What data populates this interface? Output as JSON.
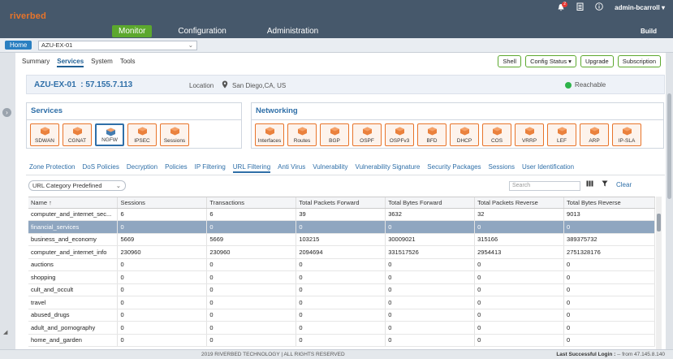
{
  "brand": {
    "logo_text": "riverbed",
    "color": "#e8742a"
  },
  "topnav": {
    "items": [
      {
        "label": "Monitor",
        "active": true
      },
      {
        "label": "Configuration",
        "active": false
      },
      {
        "label": "Administration",
        "active": false
      }
    ],
    "notifications_count": "2",
    "user": "admin-bcarroll",
    "build_label": "Build"
  },
  "devbar": {
    "home_label": "Home",
    "device_value": "AZU-EX-01"
  },
  "subnav": {
    "items": [
      "Summary",
      "Services",
      "System",
      "Tools"
    ],
    "active": "Services",
    "actions": [
      "Shell",
      "Config Status ▾",
      "Upgrade",
      "Subscription"
    ]
  },
  "device": {
    "name": "AZU-EX-01",
    "ip": ": 57.155.7.113",
    "location_label": "Location",
    "location_value": "San Diego,CA, US",
    "status": "Reachable",
    "status_color": "#2db34a"
  },
  "services_panel": {
    "title": "Services",
    "items": [
      {
        "label": "SDWAN",
        "icon": "sdwan-icon"
      },
      {
        "label": "CGNAT",
        "icon": "cgnat-icon"
      },
      {
        "label": "NGFW",
        "icon": "ngfw-icon",
        "selected": true
      },
      {
        "label": "IPSEC",
        "icon": "ipsec-icon"
      },
      {
        "label": "Sessions",
        "icon": "sessions-icon"
      }
    ]
  },
  "networking_panel": {
    "title": "Networking",
    "items": [
      {
        "label": "Interfaces",
        "icon": "interfaces-icon"
      },
      {
        "label": "Routes",
        "icon": "routes-icon"
      },
      {
        "label": "BGP",
        "icon": "bgp-icon"
      },
      {
        "label": "OSPF",
        "icon": "ospf-icon"
      },
      {
        "label": "OSPFv3",
        "icon": "ospfv3-icon"
      },
      {
        "label": "BFD",
        "icon": "bfd-icon"
      },
      {
        "label": "DHCP",
        "icon": "dhcp-icon"
      },
      {
        "label": "COS",
        "icon": "cos-icon"
      },
      {
        "label": "VRRP",
        "icon": "vrrp-icon"
      },
      {
        "label": "LEF",
        "icon": "lef-icon"
      },
      {
        "label": "ARP",
        "icon": "arp-icon"
      },
      {
        "label": "IP-SLA",
        "icon": "ipsla-icon"
      }
    ]
  },
  "tabs": {
    "items": [
      "Zone Protection",
      "DoS Policies",
      "Decryption",
      "Policies",
      "IP Filtering",
      "URL Filtering",
      "Anti Virus",
      "Vulnerability",
      "Vulnerability Signature",
      "Security Packages",
      "Sessions",
      "User Identification"
    ],
    "active": "URL Filtering"
  },
  "filter": {
    "value": "URL Category Predefined",
    "search_placeholder": "Search",
    "clear_label": "Clear"
  },
  "table": {
    "columns": [
      "Name ↑",
      "Sessions",
      "Transactions",
      "Total Packets Forward",
      "Total Bytes Forward",
      "Total Packets Reverse",
      "Total Bytes Reverse"
    ],
    "rows": [
      [
        "computer_and_internet_sec...",
        "6",
        "6",
        "39",
        "3632",
        "32",
        "9013"
      ],
      [
        "financial_services",
        "0",
        "0",
        "0",
        "0",
        "0",
        "0"
      ],
      [
        "business_and_economy",
        "5669",
        "5669",
        "103215",
        "30009021",
        "315166",
        "389375732"
      ],
      [
        "computer_and_internet_info",
        "230960",
        "230960",
        "2094694",
        "331517526",
        "2954413",
        "2751328176"
      ],
      [
        "auctions",
        "0",
        "0",
        "0",
        "0",
        "0",
        "0"
      ],
      [
        "shopping",
        "0",
        "0",
        "0",
        "0",
        "0",
        "0"
      ],
      [
        "cult_and_occult",
        "0",
        "0",
        "0",
        "0",
        "0",
        "0"
      ],
      [
        "travel",
        "0",
        "0",
        "0",
        "0",
        "0",
        "0"
      ],
      [
        "abused_drugs",
        "0",
        "0",
        "0",
        "0",
        "0",
        "0"
      ],
      [
        "adult_and_pornography",
        "0",
        "0",
        "0",
        "0",
        "0",
        "0"
      ],
      [
        "home_and_garden",
        "0",
        "0",
        "0",
        "0",
        "0",
        "0"
      ]
    ],
    "selected_row": 1
  },
  "footer": {
    "copyright": "2019 RIVERBED TECHNOLOGY | ALL RIGHTS RESERVED",
    "last_login_label": "Last Successful Login :",
    "last_login_value": "-- from 47.145.8.140"
  }
}
